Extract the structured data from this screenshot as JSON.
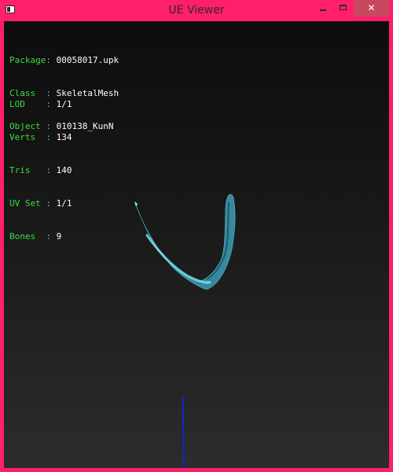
{
  "window": {
    "title": "UE Viewer",
    "controls": {
      "minimize": "minimize-icon",
      "maximize": "maximize-icon",
      "close": "close-icon"
    },
    "colors": {
      "frame": "#ff1f6b",
      "close_button": "#c8485d"
    }
  },
  "info": {
    "object": [
      {
        "key": "Package: ",
        "value": "00058017.upk"
      },
      {
        "key": "Class  : ",
        "value": "SkeletalMesh"
      },
      {
        "key": "Object : ",
        "value": "010138_KunN"
      }
    ],
    "mesh": [
      {
        "key": "LOD    : ",
        "value": "1/1"
      },
      {
        "key": "Verts  : ",
        "value": "134"
      },
      {
        "key": "Tris   : ",
        "value": "140"
      },
      {
        "key": "UV Set : ",
        "value": "1/1"
      },
      {
        "key": "Bones  : ",
        "value": "9"
      }
    ],
    "colors": {
      "key": "#3ddc3d",
      "value": "#ffffff"
    }
  },
  "scene": {
    "mesh_color": "#3fa9c2",
    "axis_color": "#1a1aff"
  }
}
